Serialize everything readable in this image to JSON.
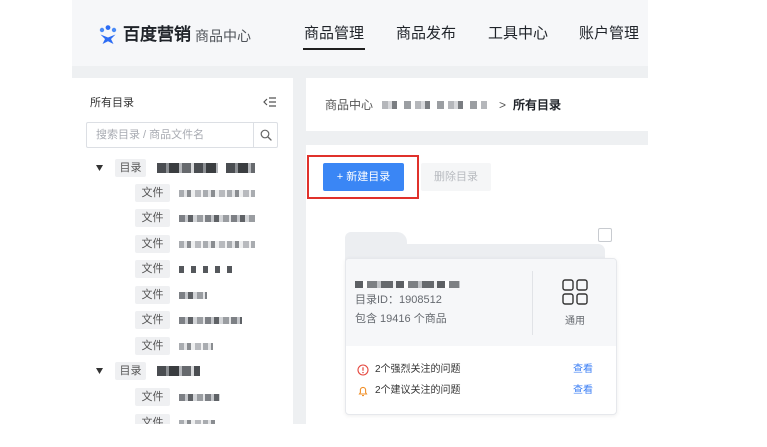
{
  "header": {
    "brand": "百度营销",
    "product": "商品中心",
    "logo_icon": "baidu-marketing-logo-icon",
    "nav": [
      {
        "label": "商品管理",
        "active": true
      },
      {
        "label": "商品发布",
        "active": false
      },
      {
        "label": "工具中心",
        "active": false
      },
      {
        "label": "账户管理",
        "active": false
      }
    ]
  },
  "sidebar": {
    "title": "所有目录",
    "collapse_icon": "collapse-sidebar-icon",
    "search": {
      "placeholder": "搜索目录 / 商品文件名",
      "value": "",
      "icon": "search-icon"
    },
    "tree": [
      {
        "tag": "目录",
        "expanded": true,
        "files": [
          {
            "tag": "文件"
          },
          {
            "tag": "文件"
          },
          {
            "tag": "文件"
          },
          {
            "tag": "文件"
          },
          {
            "tag": "文件"
          },
          {
            "tag": "文件"
          },
          {
            "tag": "文件"
          }
        ]
      },
      {
        "tag": "目录",
        "expanded": true,
        "files": [
          {
            "tag": "文件"
          },
          {
            "tag": "文件"
          }
        ]
      }
    ]
  },
  "breadcrumb": {
    "root": "商品中心",
    "separator": ">",
    "current": "所有目录"
  },
  "toolbar": {
    "create_label": "+ 新建目录",
    "delete_label": "删除目录",
    "delete_disabled": true
  },
  "catalog_card": {
    "selected": false,
    "id_text": "目录ID：1908512",
    "count_text": "包含 19416 个商品",
    "type_icon": "grid-icon",
    "type_label": "通用",
    "issues": [
      {
        "icon": "error-circle-icon",
        "text": "2个强烈关注的问题",
        "action": "查看"
      },
      {
        "icon": "warning-bell-icon",
        "text": "2个建议关注的问题",
        "action": "查看"
      }
    ]
  },
  "colors": {
    "primary": "#3a86f5",
    "link": "#3a7ef5",
    "highlight": "#e0312b",
    "danger": "#e5473e",
    "warning": "#f0902a"
  }
}
